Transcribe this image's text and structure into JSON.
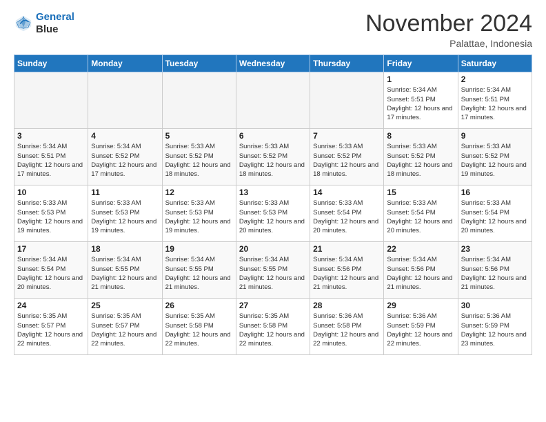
{
  "header": {
    "logo_line1": "General",
    "logo_line2": "Blue",
    "month_title": "November 2024",
    "subtitle": "Palattae, Indonesia"
  },
  "weekdays": [
    "Sunday",
    "Monday",
    "Tuesday",
    "Wednesday",
    "Thursday",
    "Friday",
    "Saturday"
  ],
  "weeks": [
    [
      {
        "day": "",
        "info": ""
      },
      {
        "day": "",
        "info": ""
      },
      {
        "day": "",
        "info": ""
      },
      {
        "day": "",
        "info": ""
      },
      {
        "day": "",
        "info": ""
      },
      {
        "day": "1",
        "info": "Sunrise: 5:34 AM\nSunset: 5:51 PM\nDaylight: 12 hours and 17 minutes."
      },
      {
        "day": "2",
        "info": "Sunrise: 5:34 AM\nSunset: 5:51 PM\nDaylight: 12 hours and 17 minutes."
      }
    ],
    [
      {
        "day": "3",
        "info": "Sunrise: 5:34 AM\nSunset: 5:51 PM\nDaylight: 12 hours and 17 minutes."
      },
      {
        "day": "4",
        "info": "Sunrise: 5:34 AM\nSunset: 5:52 PM\nDaylight: 12 hours and 17 minutes."
      },
      {
        "day": "5",
        "info": "Sunrise: 5:33 AM\nSunset: 5:52 PM\nDaylight: 12 hours and 18 minutes."
      },
      {
        "day": "6",
        "info": "Sunrise: 5:33 AM\nSunset: 5:52 PM\nDaylight: 12 hours and 18 minutes."
      },
      {
        "day": "7",
        "info": "Sunrise: 5:33 AM\nSunset: 5:52 PM\nDaylight: 12 hours and 18 minutes."
      },
      {
        "day": "8",
        "info": "Sunrise: 5:33 AM\nSunset: 5:52 PM\nDaylight: 12 hours and 18 minutes."
      },
      {
        "day": "9",
        "info": "Sunrise: 5:33 AM\nSunset: 5:52 PM\nDaylight: 12 hours and 19 minutes."
      }
    ],
    [
      {
        "day": "10",
        "info": "Sunrise: 5:33 AM\nSunset: 5:53 PM\nDaylight: 12 hours and 19 minutes."
      },
      {
        "day": "11",
        "info": "Sunrise: 5:33 AM\nSunset: 5:53 PM\nDaylight: 12 hours and 19 minutes."
      },
      {
        "day": "12",
        "info": "Sunrise: 5:33 AM\nSunset: 5:53 PM\nDaylight: 12 hours and 19 minutes."
      },
      {
        "day": "13",
        "info": "Sunrise: 5:33 AM\nSunset: 5:53 PM\nDaylight: 12 hours and 20 minutes."
      },
      {
        "day": "14",
        "info": "Sunrise: 5:33 AM\nSunset: 5:54 PM\nDaylight: 12 hours and 20 minutes."
      },
      {
        "day": "15",
        "info": "Sunrise: 5:33 AM\nSunset: 5:54 PM\nDaylight: 12 hours and 20 minutes."
      },
      {
        "day": "16",
        "info": "Sunrise: 5:33 AM\nSunset: 5:54 PM\nDaylight: 12 hours and 20 minutes."
      }
    ],
    [
      {
        "day": "17",
        "info": "Sunrise: 5:34 AM\nSunset: 5:54 PM\nDaylight: 12 hours and 20 minutes."
      },
      {
        "day": "18",
        "info": "Sunrise: 5:34 AM\nSunset: 5:55 PM\nDaylight: 12 hours and 21 minutes."
      },
      {
        "day": "19",
        "info": "Sunrise: 5:34 AM\nSunset: 5:55 PM\nDaylight: 12 hours and 21 minutes."
      },
      {
        "day": "20",
        "info": "Sunrise: 5:34 AM\nSunset: 5:55 PM\nDaylight: 12 hours and 21 minutes."
      },
      {
        "day": "21",
        "info": "Sunrise: 5:34 AM\nSunset: 5:56 PM\nDaylight: 12 hours and 21 minutes."
      },
      {
        "day": "22",
        "info": "Sunrise: 5:34 AM\nSunset: 5:56 PM\nDaylight: 12 hours and 21 minutes."
      },
      {
        "day": "23",
        "info": "Sunrise: 5:34 AM\nSunset: 5:56 PM\nDaylight: 12 hours and 21 minutes."
      }
    ],
    [
      {
        "day": "24",
        "info": "Sunrise: 5:35 AM\nSunset: 5:57 PM\nDaylight: 12 hours and 22 minutes."
      },
      {
        "day": "25",
        "info": "Sunrise: 5:35 AM\nSunset: 5:57 PM\nDaylight: 12 hours and 22 minutes."
      },
      {
        "day": "26",
        "info": "Sunrise: 5:35 AM\nSunset: 5:58 PM\nDaylight: 12 hours and 22 minutes."
      },
      {
        "day": "27",
        "info": "Sunrise: 5:35 AM\nSunset: 5:58 PM\nDaylight: 12 hours and 22 minutes."
      },
      {
        "day": "28",
        "info": "Sunrise: 5:36 AM\nSunset: 5:58 PM\nDaylight: 12 hours and 22 minutes."
      },
      {
        "day": "29",
        "info": "Sunrise: 5:36 AM\nSunset: 5:59 PM\nDaylight: 12 hours and 22 minutes."
      },
      {
        "day": "30",
        "info": "Sunrise: 5:36 AM\nSunset: 5:59 PM\nDaylight: 12 hours and 23 minutes."
      }
    ]
  ]
}
